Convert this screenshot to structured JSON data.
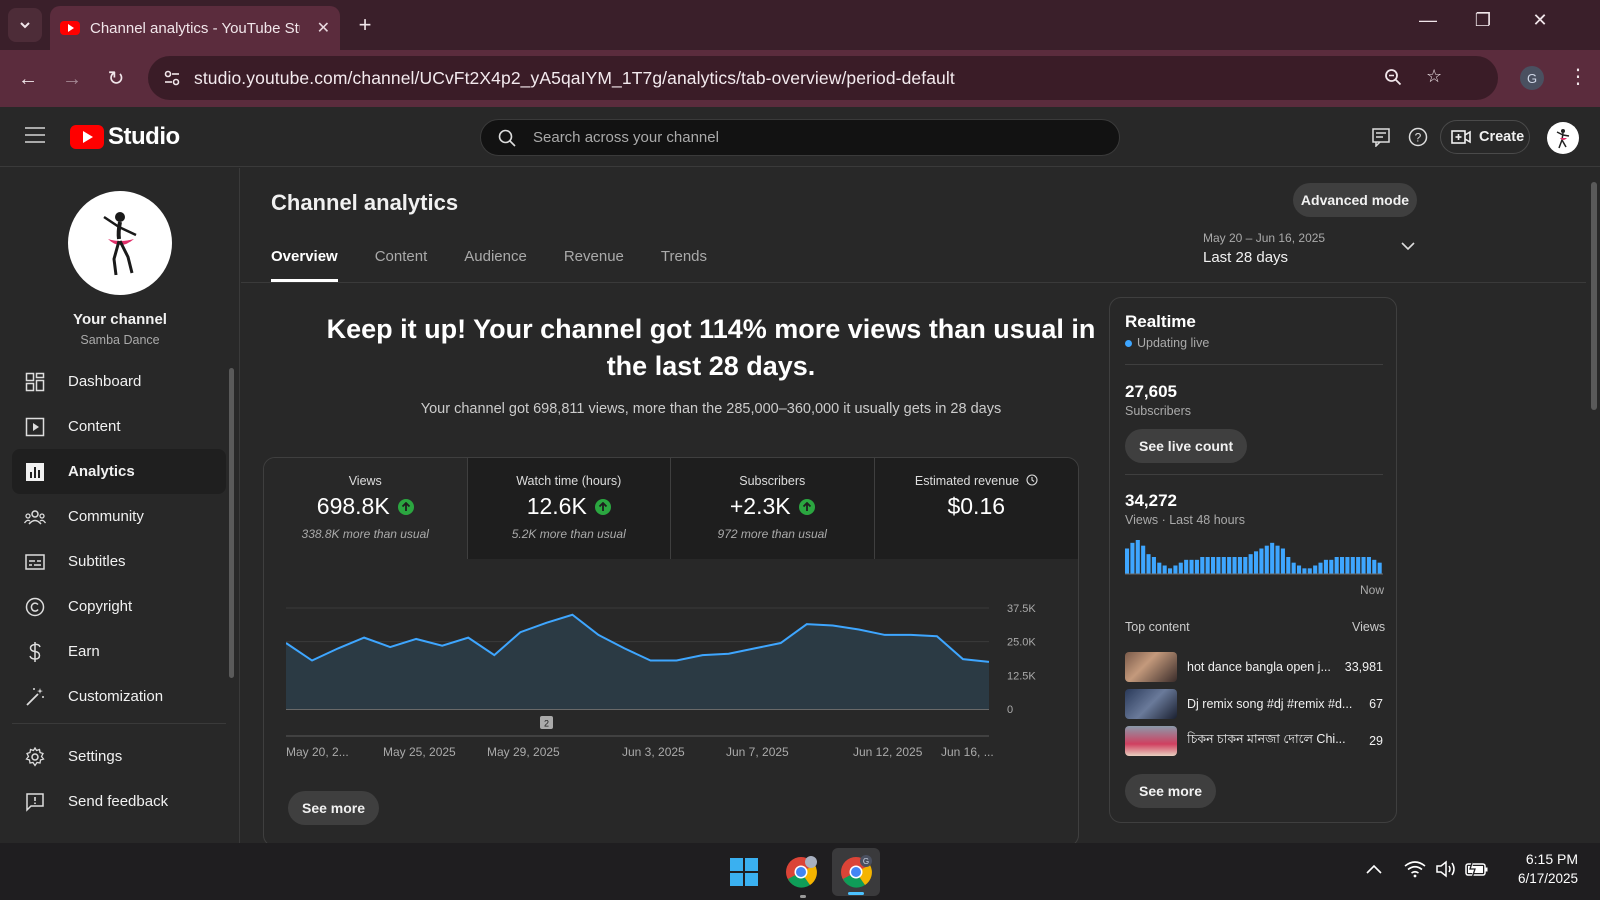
{
  "browser": {
    "tab_title": "Channel analytics - YouTube Stu",
    "url": "studio.youtube.com/channel/UCvFt2X4p2_yA5qaIYM_1T7g/analytics/tab-overview/period-default",
    "profile_initial": "G"
  },
  "header": {
    "logo_text": "Studio",
    "search_placeholder": "Search across your channel",
    "create_label": "Create"
  },
  "sidebar": {
    "your_channel": "Your channel",
    "channel_name": "Samba Dance",
    "items": [
      {
        "label": "Dashboard",
        "icon": "dashboard-icon"
      },
      {
        "label": "Content",
        "icon": "content-icon"
      },
      {
        "label": "Analytics",
        "icon": "analytics-icon",
        "active": true
      },
      {
        "label": "Community",
        "icon": "community-icon"
      },
      {
        "label": "Subtitles",
        "icon": "subtitles-icon"
      },
      {
        "label": "Copyright",
        "icon": "copyright-icon"
      },
      {
        "label": "Earn",
        "icon": "earn-icon"
      },
      {
        "label": "Customization",
        "icon": "customization-icon"
      }
    ],
    "bottom_items": [
      {
        "label": "Settings",
        "icon": "settings-icon"
      },
      {
        "label": "Send feedback",
        "icon": "feedback-icon"
      }
    ]
  },
  "main": {
    "title": "Channel analytics",
    "advanced_mode": "Advanced mode",
    "tabs": [
      "Overview",
      "Content",
      "Audience",
      "Revenue",
      "Trends"
    ],
    "active_tab": "Overview",
    "date_range": "May 20 – Jun 16, 2025",
    "period": "Last 28 days",
    "headline": "Keep it up! Your channel got 114% more views than usual in the last 28 days.",
    "subline": "Your channel got 698,811 views, more than the 285,000–360,000 it usually gets in 28 days",
    "metrics": [
      {
        "label": "Views",
        "value": "698.8K",
        "comparison": "338.8K more than usual",
        "trend": "up"
      },
      {
        "label": "Watch time (hours)",
        "value": "12.6K",
        "comparison": "5.2K more than usual",
        "trend": "up"
      },
      {
        "label": "Subscribers",
        "value": "+2.3K",
        "comparison": "972 more than usual",
        "trend": "up"
      },
      {
        "label": "Estimated revenue",
        "value": "$0.16",
        "comparison": "",
        "trend": "none"
      }
    ],
    "see_more": "See more",
    "chart_marker": "2"
  },
  "chart_data": {
    "type": "area",
    "x": [
      "May 20, 2...",
      "May 25, 2025",
      "May 29, 2025",
      "Jun 3, 2025",
      "Jun 7, 2025",
      "Jun 12, 2025",
      "Jun 16, ..."
    ],
    "y_ticks": [
      "37.5K",
      "25.0K",
      "12.5K",
      "0"
    ],
    "ylim": [
      0,
      37500
    ],
    "series": [
      {
        "values": [
          24500,
          18000,
          22500,
          26500,
          23000,
          26000,
          23500,
          26500,
          20000,
          28500,
          32000,
          35000,
          27500,
          22500,
          18000,
          18000,
          20000,
          20500,
          22500,
          24500,
          31500,
          31000,
          29500,
          27500,
          27500,
          27000,
          18500,
          17500
        ]
      }
    ],
    "color": "#3ea6ff"
  },
  "realtime": {
    "title": "Realtime",
    "status": "Updating live",
    "subscribers_value": "27,605",
    "subscribers_label": "Subscribers",
    "see_live_count": "See live count",
    "views_value": "34,272",
    "views_label": "Views · Last 48 hours",
    "now_label": "Now",
    "bars": [
      9,
      11,
      12,
      10,
      7,
      6,
      4,
      3,
      2,
      3,
      4,
      5,
      5,
      5,
      6,
      6,
      6,
      6,
      6,
      6,
      6,
      6,
      6,
      7,
      8,
      9,
      10,
      11,
      10,
      9,
      6,
      4,
      3,
      2,
      2,
      3,
      4,
      5,
      5,
      6,
      6,
      6,
      6,
      6,
      6,
      6,
      5,
      4
    ],
    "top_content_label": "Top content",
    "views_col_label": "Views",
    "top_content": [
      {
        "title": "hot dance bangla open j...",
        "views": "33,981"
      },
      {
        "title": "Dj remix song #dj #remix #d...",
        "views": "67"
      },
      {
        "title": "চিকন চাকন মানজা দোলে Chi...",
        "views": "29"
      }
    ],
    "see_more": "See more"
  },
  "taskbar": {
    "time": "6:15 PM",
    "date": "6/17/2025"
  }
}
